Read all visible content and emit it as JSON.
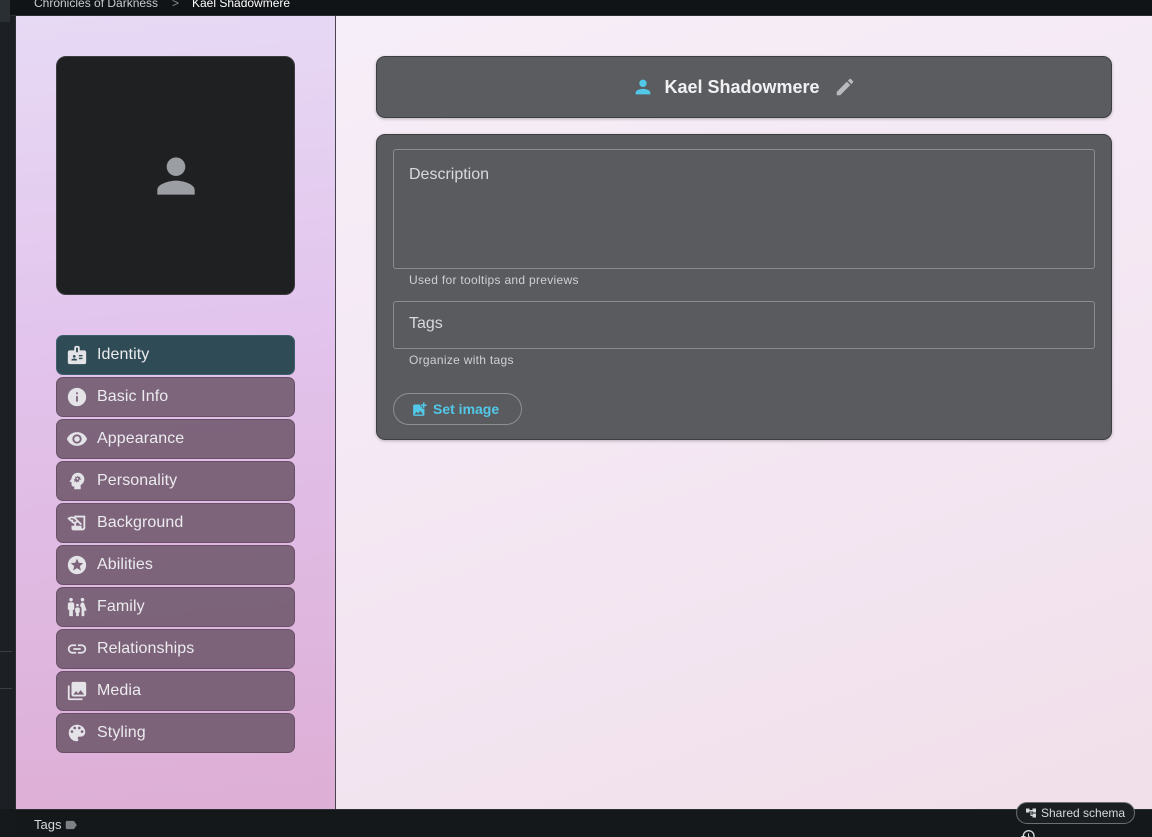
{
  "breadcrumb": {
    "world": "Chronicles of Darkness",
    "separator": ">",
    "current": "Kael Shadowmere"
  },
  "character": {
    "name": "Kael Shadowmere"
  },
  "nav": {
    "items": [
      {
        "label": "Identity",
        "icon": "badge-icon",
        "active": true
      },
      {
        "label": "Basic Info",
        "icon": "info-icon"
      },
      {
        "label": "Appearance",
        "icon": "eye-icon"
      },
      {
        "label": "Personality",
        "icon": "head-gear-icon"
      },
      {
        "label": "Background",
        "icon": "history-edu-icon"
      },
      {
        "label": "Abilities",
        "icon": "star-icon"
      },
      {
        "label": "Family",
        "icon": "family-icon"
      },
      {
        "label": "Relationships",
        "icon": "link-icon"
      },
      {
        "label": "Media",
        "icon": "photo-library-icon"
      },
      {
        "label": "Styling",
        "icon": "palette-icon"
      }
    ]
  },
  "form": {
    "description_label": "Description",
    "description_hint": "Used for tooltips and previews",
    "tags_label": "Tags",
    "tags_hint": "Organize with tags",
    "set_image_label": "Set image"
  },
  "footer": {
    "tags_label": "Tags",
    "shared_schema_label": "Shared schema"
  },
  "colors": {
    "accent": "#52c8e8",
    "active_nav": "#2f4b55",
    "card": "#5a5b5e"
  }
}
